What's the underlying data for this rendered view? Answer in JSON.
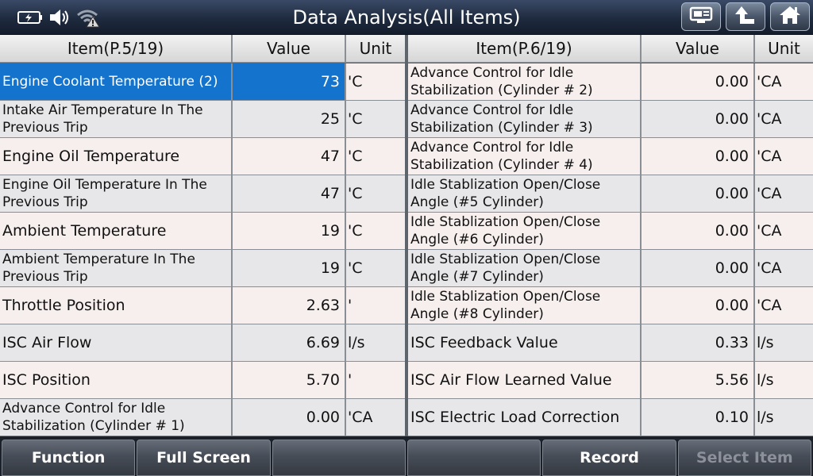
{
  "header": {
    "title": "Data Analysis(All Items)",
    "icons": [
      "battery-charging-icon",
      "speaker-icon",
      "wifi-warning-icon"
    ],
    "nav": [
      "monitor-icon",
      "back-arrow-icon",
      "home-icon"
    ]
  },
  "left_table": {
    "headers": {
      "item": "Item(P.5/19)",
      "value": "Value",
      "unit": "Unit"
    },
    "rows": [
      {
        "item": "Engine Coolant Temperature (2)",
        "value": "73",
        "unit": "'C"
      },
      {
        "item": "Intake Air Temperature In The Previous Trip",
        "value": "25",
        "unit": "'C"
      },
      {
        "item": "Engine Oil Temperature",
        "value": "47",
        "unit": "'C"
      },
      {
        "item": "Engine Oil Temperature In The Previous Trip",
        "value": "47",
        "unit": "'C"
      },
      {
        "item": "Ambient Temperature",
        "value": "19",
        "unit": "'C"
      },
      {
        "item": "Ambient Temperature In The Previous Trip",
        "value": "19",
        "unit": "'C"
      },
      {
        "item": "Throttle Position",
        "value": "2.63",
        "unit": "'"
      },
      {
        "item": "ISC Air Flow",
        "value": "6.69",
        "unit": "l/s"
      },
      {
        "item": "ISC Position",
        "value": "5.70",
        "unit": "'"
      },
      {
        "item": "Advance Control for Idle Stabilization (Cylinder # 1)",
        "value": "0.00",
        "unit": "'CA"
      }
    ]
  },
  "right_table": {
    "headers": {
      "item": "Item(P.6/19)",
      "value": "Value",
      "unit": "Unit"
    },
    "rows": [
      {
        "item": "Advance Control for Idle Stabilization (Cylinder # 2)",
        "value": "0.00",
        "unit": "'CA"
      },
      {
        "item": "Advance Control for Idle Stabilization (Cylinder # 3)",
        "value": "0.00",
        "unit": "'CA"
      },
      {
        "item": "Advance Control for Idle Stabilization (Cylinder # 4)",
        "value": "0.00",
        "unit": "'CA"
      },
      {
        "item": "Idle Stablization Open/Close Angle (#5 Cylinder)",
        "value": "0.00",
        "unit": "'CA"
      },
      {
        "item": "Idle Stablization Open/Close Angle (#6 Cylinder)",
        "value": "0.00",
        "unit": "'CA"
      },
      {
        "item": "Idle Stablization Open/Close Angle (#7 Cylinder)",
        "value": "0.00",
        "unit": "'CA"
      },
      {
        "item": "Idle Stablization Open/Close Angle (#8 Cylinder)",
        "value": "0.00",
        "unit": "'CA"
      },
      {
        "item": "ISC Feedback Value",
        "value": "0.33",
        "unit": "l/s"
      },
      {
        "item": "ISC Air Flow Learned Value",
        "value": "5.56",
        "unit": "l/s"
      },
      {
        "item": "ISC Electric Load Correction",
        "value": "0.10",
        "unit": "l/s"
      }
    ]
  },
  "footer": {
    "buttons": [
      {
        "label": "Function",
        "enabled": true
      },
      {
        "label": "Full Screen",
        "enabled": true
      },
      {
        "label": "",
        "enabled": true
      },
      {
        "label": "",
        "enabled": true
      },
      {
        "label": "Record",
        "enabled": true
      },
      {
        "label": "Select Item",
        "enabled": false
      }
    ]
  },
  "colors": {
    "selected_row": "#1473cc",
    "title_bar": "#1e2a3e"
  }
}
